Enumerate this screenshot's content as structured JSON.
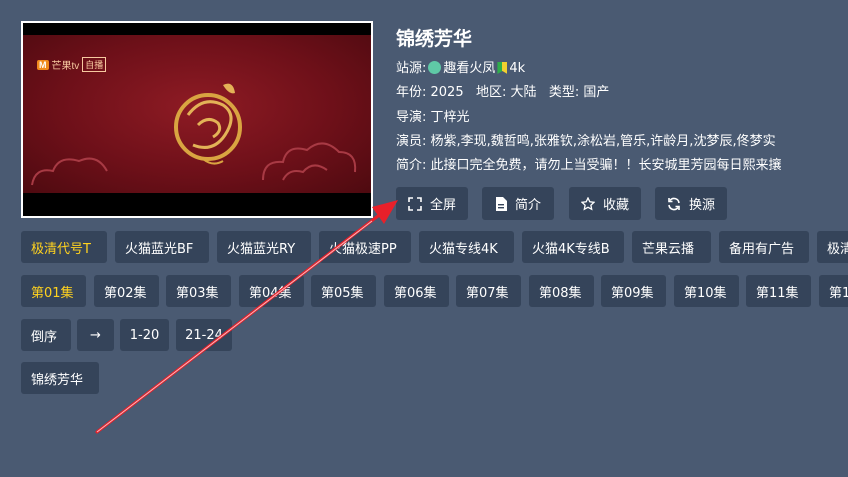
{
  "player": {
    "logo_text": "芒果tv",
    "logo_live": "自播"
  },
  "detail": {
    "title": "锦绣芳华",
    "source_label": "站源:",
    "source_name": "趣看火凤",
    "source_tag": "4k",
    "meta": "年份: 2025   地区: 大陆   类型: 国产",
    "director": "导演: 丁梓光",
    "cast": "演员: 杨紫,李现,魏哲鸣,张雅钦,涂松岩,管乐,许龄月,沈梦辰,佟梦实",
    "summary": "简介: 此接口完全免费，请勿上当受骗！！长安城里芳园每日熙来攘"
  },
  "actions": [
    {
      "label": "全屏",
      "icon": "fullscreen-icon"
    },
    {
      "label": "简介",
      "icon": "document-icon"
    },
    {
      "label": "收藏",
      "icon": "star-icon"
    },
    {
      "label": "换源",
      "icon": "refresh-icon"
    }
  ],
  "sources": [
    "极清代号T",
    "火猫蓝光BF",
    "火猫蓝光RY",
    "火猫极速PP",
    "火猫专线4K",
    "火猫4K专线B",
    "芒果云播",
    "备用有广告",
    "极清"
  ],
  "episodes": [
    "第01集",
    "第02集",
    "第03集",
    "第04集",
    "第05集",
    "第06集",
    "第07集",
    "第08集",
    "第09集",
    "第10集",
    "第11集",
    "第1"
  ],
  "controls": {
    "reverse": "倒序",
    "arrow": "→",
    "range1": "1-20",
    "range2": "21-24"
  },
  "related": [
    "锦绣芳华"
  ],
  "colors": {
    "background": "#4a5a72",
    "chip": "#35445a",
    "selected": "#ffd21f",
    "annotation_arrow": "#e8202a"
  }
}
